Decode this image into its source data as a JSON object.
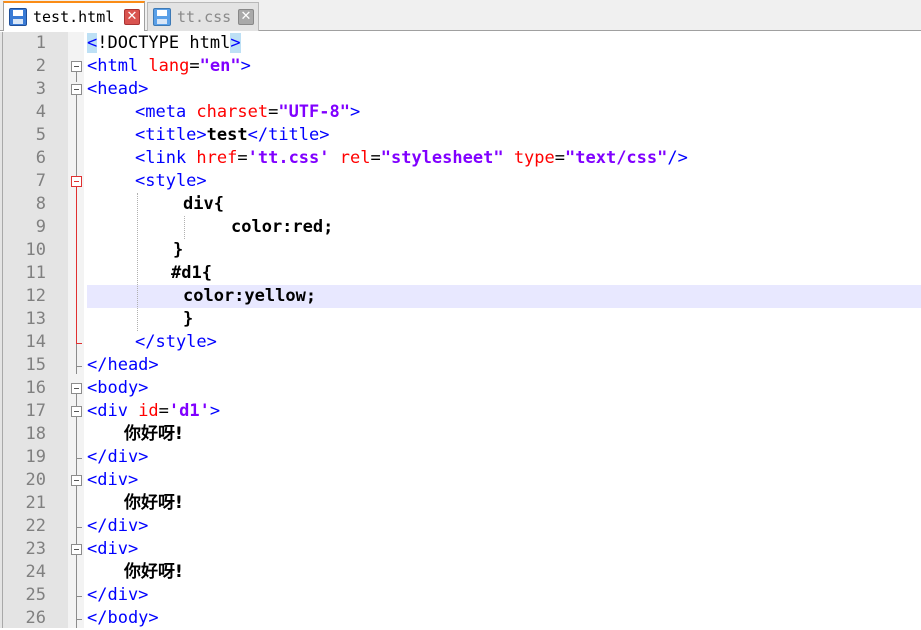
{
  "tabs": [
    {
      "label": "test.html",
      "active": true
    },
    {
      "label": "tt.css",
      "active": false
    }
  ],
  "line_numbers": [
    "1",
    "2",
    "3",
    "4",
    "5",
    "6",
    "7",
    "8",
    "9",
    "10",
    "11",
    "12",
    "13",
    "14",
    "15",
    "16",
    "17",
    "18",
    "19",
    "20",
    "21",
    "22",
    "23",
    "24",
    "25",
    "26"
  ],
  "code": {
    "l1": {
      "a": "<",
      "b": "!DOCTYPE html",
      "c": ">"
    },
    "l2": {
      "a": "<html ",
      "b": "lang",
      "c": "=",
      "d": "\"en\"",
      "e": ">"
    },
    "l3": {
      "a": "<head>"
    },
    "l4": {
      "a": "<meta ",
      "b": "charset",
      "c": "=",
      "d": "\"UTF-8\"",
      "e": ">"
    },
    "l5": {
      "a": "<title>",
      "b": "test",
      "c": "</title>"
    },
    "l6": {
      "a": "<link ",
      "b": "href",
      "c": "=",
      "d": "'tt.css'",
      "e": " ",
      "f": "rel",
      "g": "=",
      "h": "\"stylesheet\"",
      "i": " ",
      "j": "type",
      "k": "=",
      "l": "\"text/css\"",
      "m": "/>"
    },
    "l7": {
      "a": "<style>"
    },
    "l8": {
      "a": "div{"
    },
    "l9": {
      "a": "color:red;"
    },
    "l10": {
      "a": "}"
    },
    "l11": {
      "a": "#d1{"
    },
    "l12": {
      "a": "color:yellow;"
    },
    "l13": {
      "a": "}"
    },
    "l14": {
      "a": "</style>"
    },
    "l15": {
      "a": "</head>"
    },
    "l16": {
      "a": "<body>"
    },
    "l17": {
      "a": "<div ",
      "b": "id",
      "c": "=",
      "d": "'d1'",
      "e": ">"
    },
    "l18": {
      "a": "你好呀!"
    },
    "l19": {
      "a": "</div>"
    },
    "l20": {
      "a": "<div>"
    },
    "l21": {
      "a": "你好呀!"
    },
    "l22": {
      "a": "</div>"
    },
    "l23": {
      "a": "<div>"
    },
    "l24": {
      "a": "你好呀!"
    },
    "l25": {
      "a": "</div>"
    },
    "l26": {
      "a": "</body>"
    }
  }
}
